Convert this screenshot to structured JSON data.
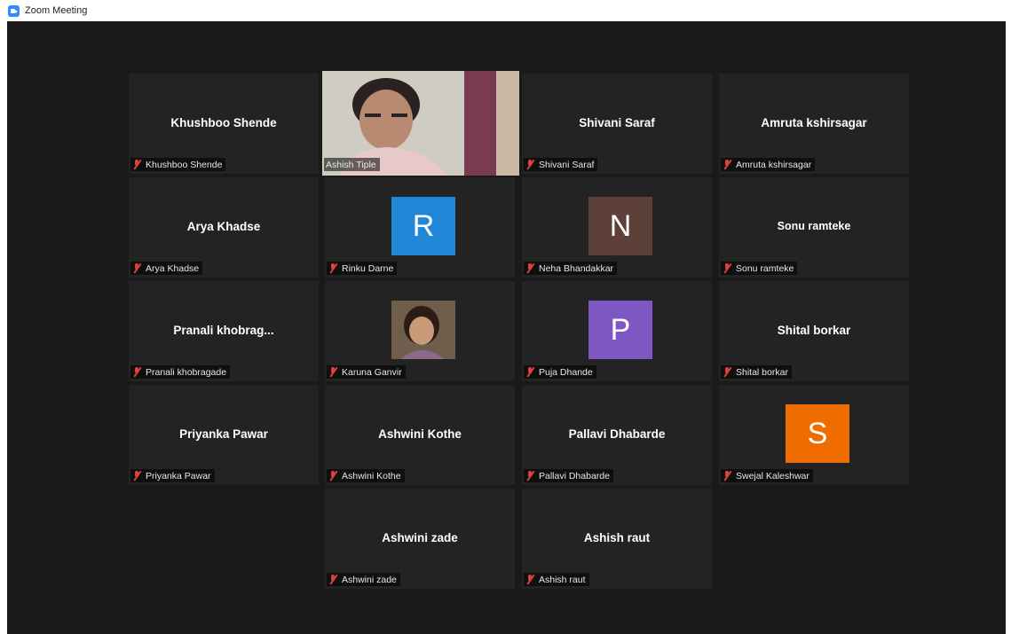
{
  "window": {
    "title": "Zoom Meeting"
  },
  "colors": {
    "active_speaker_border": "#d4e157",
    "muted": "#e0403a",
    "tile_bg": "#232323",
    "stage_bg": "#1a1a1a"
  },
  "participants": [
    {
      "big_name": "Khushboo Shende",
      "label": "Khushboo Shende",
      "muted": true,
      "display": "name"
    },
    {
      "big_name": "",
      "label": "Ashish Tiple",
      "muted": false,
      "display": "video",
      "active_speaker": true
    },
    {
      "big_name": "Shivani Saraf",
      "label": "Shivani Saraf",
      "muted": true,
      "display": "name"
    },
    {
      "big_name": "Amruta kshirsagar",
      "label": "Amruta kshirsagar",
      "muted": true,
      "display": "name"
    },
    {
      "big_name": "Arya Khadse",
      "label": "Arya Khadse",
      "muted": true,
      "display": "name"
    },
    {
      "avatar_letter": "R",
      "avatar_color": "#1f87d6",
      "label": "Rinku Darne",
      "muted": true,
      "display": "avatar"
    },
    {
      "avatar_letter": "N",
      "avatar_color": "#5d4037",
      "label": "Neha Bhandakkar",
      "muted": true,
      "display": "avatar"
    },
    {
      "big_name": "Sonu ramteke",
      "label": "Sonu ramteke",
      "muted": true,
      "display": "name"
    },
    {
      "big_name": "Pranali khobrag...",
      "label": "Pranali khobragade",
      "muted": true,
      "display": "name"
    },
    {
      "label": "Karuna Ganvir",
      "muted": true,
      "display": "photo"
    },
    {
      "avatar_letter": "P",
      "avatar_color": "#7e57c2",
      "label": "Puja Dhande",
      "muted": true,
      "display": "avatar"
    },
    {
      "big_name": "Shital borkar",
      "label": "Shital borkar",
      "muted": true,
      "display": "name"
    },
    {
      "big_name": "Priyanka Pawar",
      "label": "Priyanka Pawar",
      "muted": true,
      "display": "name"
    },
    {
      "big_name": "Ashwini Kothe",
      "label": "Ashwini Kothe",
      "muted": true,
      "display": "name"
    },
    {
      "big_name": "Pallavi Dhabarde",
      "label": "Pallavi Dhabarde",
      "muted": true,
      "display": "name"
    },
    {
      "avatar_letter": "S",
      "avatar_color": "#ef6c00",
      "label": "Swejal Kaleshwar",
      "muted": true,
      "display": "avatar"
    },
    {
      "big_name": "Ashwini zade",
      "label": "Ashwini zade",
      "muted": true,
      "display": "name"
    },
    {
      "big_name": "Ashish  raut",
      "label": "Ashish  raut",
      "muted": true,
      "display": "name"
    }
  ]
}
